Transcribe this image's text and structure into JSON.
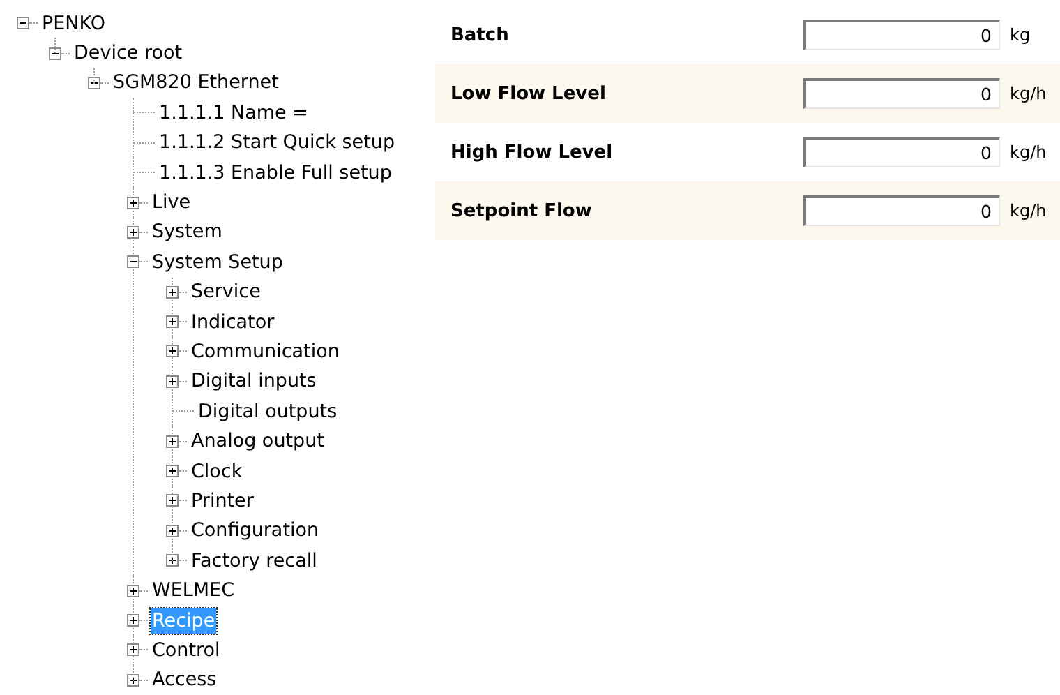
{
  "tree": [
    {
      "label": "PENKO",
      "kind": "folder",
      "expanded": true,
      "selected": false,
      "children": [
        {
          "label": "Device root",
          "kind": "folder",
          "expanded": true,
          "selected": false,
          "children": [
            {
              "label": "SGM820 Ethernet",
              "kind": "folder",
              "expanded": true,
              "selected": false,
              "children": [
                {
                  "label": "1.1.1.1 Name =",
                  "kind": "leaf",
                  "selected": false
                },
                {
                  "label": "1.1.1.2 Start Quick setup",
                  "kind": "leaf",
                  "selected": false
                },
                {
                  "label": "1.1.1.3 Enable Full setup",
                  "kind": "leaf",
                  "selected": false
                },
                {
                  "label": "Live",
                  "kind": "folder",
                  "expanded": false,
                  "selected": false
                },
                {
                  "label": "System",
                  "kind": "folder",
                  "expanded": false,
                  "selected": false
                },
                {
                  "label": "System Setup",
                  "kind": "folder",
                  "expanded": true,
                  "selected": false,
                  "children": [
                    {
                      "label": "Service",
                      "kind": "folder",
                      "expanded": false,
                      "selected": false
                    },
                    {
                      "label": "Indicator",
                      "kind": "folder",
                      "expanded": false,
                      "selected": false
                    },
                    {
                      "label": "Communication",
                      "kind": "folder",
                      "expanded": false,
                      "selected": false
                    },
                    {
                      "label": "Digital inputs",
                      "kind": "folder",
                      "expanded": false,
                      "selected": false
                    },
                    {
                      "label": "Digital outputs",
                      "kind": "leaf",
                      "selected": false
                    },
                    {
                      "label": "Analog output",
                      "kind": "folder",
                      "expanded": false,
                      "selected": false
                    },
                    {
                      "label": "Clock",
                      "kind": "folder",
                      "expanded": false,
                      "selected": false
                    },
                    {
                      "label": "Printer",
                      "kind": "folder",
                      "expanded": false,
                      "selected": false
                    },
                    {
                      "label": "Configuration",
                      "kind": "folder",
                      "expanded": false,
                      "selected": false
                    },
                    {
                      "label": "Factory recall",
                      "kind": "folder",
                      "expanded": false,
                      "selected": false
                    }
                  ]
                },
                {
                  "label": "WELMEC",
                  "kind": "folder",
                  "expanded": false,
                  "selected": false
                },
                {
                  "label": "Recipe",
                  "kind": "folder",
                  "expanded": false,
                  "selected": true
                },
                {
                  "label": "Control",
                  "kind": "folder",
                  "expanded": false,
                  "selected": false
                },
                {
                  "label": "Access",
                  "kind": "folder",
                  "expanded": false,
                  "selected": false
                }
              ]
            }
          ]
        }
      ]
    }
  ],
  "fields": [
    {
      "label": "Batch",
      "value": "0",
      "unit": "kg"
    },
    {
      "label": "Low Flow Level",
      "value": "0",
      "unit": "kg/h"
    },
    {
      "label": "High Flow Level",
      "value": "0",
      "unit": "kg/h"
    },
    {
      "label": "Setpoint Flow",
      "value": "0",
      "unit": "kg/h"
    }
  ]
}
